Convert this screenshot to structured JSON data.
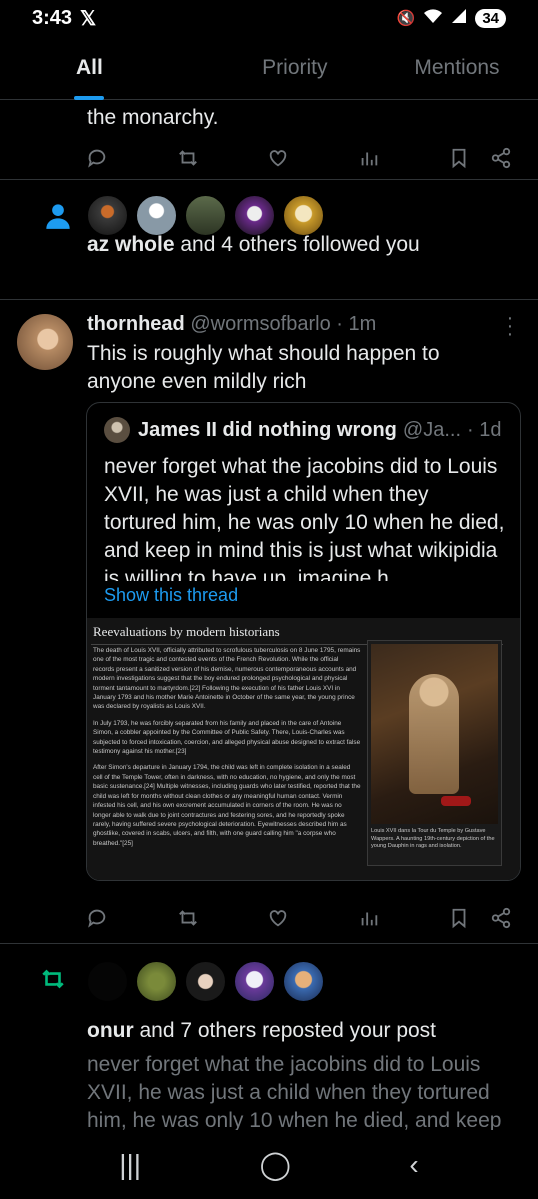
{
  "status": {
    "time": "3:43",
    "x_logo": "𝕏",
    "battery": "34"
  },
  "tabs": [
    {
      "label": "All"
    },
    {
      "label": "Priority"
    },
    {
      "label": "Mentions"
    }
  ],
  "post1": {
    "text_tail": "the monarchy."
  },
  "follow": {
    "user": "az whole",
    "rest": " and 4 others followed you"
  },
  "tweet": {
    "name": "thornhead",
    "handle": "@wormsofbarlo",
    "time": "· 1m",
    "text": "This is roughly what should happen to anyone even mildly rich",
    "quote": {
      "name": "James II did nothing wrong",
      "handle": "@Ja...",
      "time": "· 1d",
      "text": "never forget what the jacobins did to Louis XVII, he was just a child when they tortured him, he was only 10 when he died, and keep in mind this is just what wikipidia is willing to have up, imagine h...",
      "show_thread": "Show this thread",
      "wiki": {
        "heading": "Reevaluations by modern historians",
        "p1": "The death of Louis XVII, officially attributed to scrofulous tuberculosis on 8 June 1795, remains one of the most tragic and contested events of the French Revolution. While the official records present a sanitized version of his demise, numerous contemporaneous accounts and modern investigations suggest that the boy endured prolonged psychological and physical torment tantamount to martyrdom.[22] Following the execution of his father Louis XVI in January 1793 and his mother Marie Antoinette in October of the same year, the young prince was declared by royalists as Louis XVII.",
        "p2": "In July 1793, he was forcibly separated from his family and placed in the care of Antoine Simon, a cobbler appointed by the Committee of Public Safety. There, Louis-Charles was subjected to forced intoxication, coercion, and alleged physical abuse designed to extract false testimony against his mother.[23]",
        "p3": "After Simon's departure in January 1794, the child was left in complete isolation in a sealed cell of the Temple Tower, often in darkness, with no education, no hygiene, and only the most basic sustenance.[24] Multiple witnesses, including guards who later testified, reported that the child was left for months without clean clothes or any meaningful human contact. Vermin infested his cell, and his own excrement accumulated in corners of the room. He was no longer able to walk due to joint contractures and festering sores, and he reportedly spoke rarely, having suffered severe psychological deterioration. Eyewitnesses described him as ghostlike, covered in scabs, ulcers, and filth, with one guard calling him \"a corpse who breathed.\"[25]",
        "caption": "Louis XVII dans la Tour du Temple by Gustave Wappers. A haunting 19th-century depiction of the young Dauphin in rags and isolation."
      }
    }
  },
  "repost": {
    "user": "onur",
    "rest": " and 7 others reposted your post",
    "text": "never forget what the jacobins did to Louis XVII, he was just a child when they tortured him, he was only 10 when he died, and keep"
  },
  "colors": {
    "accent": "#1d9bf0",
    "green": "#00ba7c",
    "bg": "#000000",
    "muted": "#71767b"
  }
}
